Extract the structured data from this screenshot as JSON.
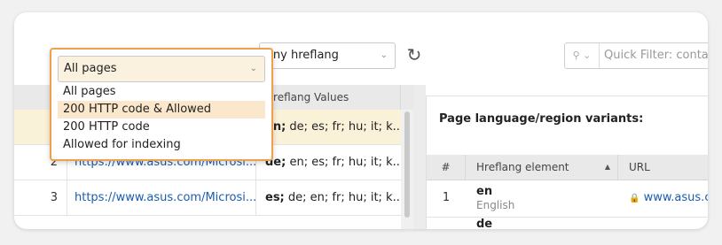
{
  "toolbar": {
    "page_filter": {
      "selected": "All pages",
      "options": [
        "All pages",
        "200 HTTP code & Allowed",
        "200 HTTP code",
        "Allowed for indexing"
      ],
      "highlighted": "200 HTTP code & Allowed"
    },
    "hreflang_filter": {
      "selected": "Any hreflang"
    },
    "quick_filter": {
      "placeholder": "Quick Filter: conta"
    }
  },
  "left_grid": {
    "headers": [
      "",
      "",
      "Hreflang Values"
    ],
    "rows": [
      {
        "num": "",
        "url": "",
        "hreflang": "en; de; es; fr; hu; it; k...",
        "bold_part": "en;",
        "rest": " de; es; fr; hu; it; k...",
        "selected": true
      },
      {
        "num": "2",
        "url": "https://www.asus.com/Microsi...",
        "bold_part": "de;",
        "rest": " en; es; fr; hu; it; k..."
      },
      {
        "num": "3",
        "url": "https://www.asus.com/Microsi...",
        "bold_part": "es;",
        "rest": " de; en; fr; hu; it; k..."
      }
    ]
  },
  "right_panel": {
    "title": "Page language/region variants:",
    "headers": [
      "#",
      "Hreflang element",
      "URL"
    ],
    "rows": [
      {
        "num": "1",
        "lang": "en",
        "lang_name": "English",
        "url": "www.asus.c"
      },
      {
        "num": "",
        "lang": "de",
        "lang_name": "",
        "url": ""
      }
    ]
  },
  "colors": {
    "accent": "#f0a04b",
    "link": "#1a5db0",
    "selected_row": "#faf1d9"
  }
}
